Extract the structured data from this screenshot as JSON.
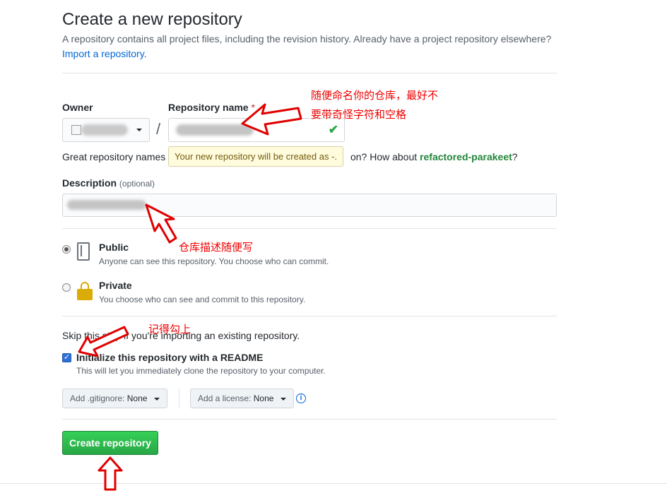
{
  "header": {
    "title": "Create a new repository",
    "subtitle": "A repository contains all project files, including the revision history. Already have a project repository elsewhere?",
    "import_link": "Import a repository."
  },
  "owner": {
    "label": "Owner"
  },
  "repo_name": {
    "label": "Repository name",
    "required_mark": "*",
    "hint_prefix": "Great repository names a",
    "hint_suffix": "on? How about",
    "suggestion": "refactored-parakeet",
    "hint_end": "?",
    "tooltip": "Your new repository will be created as -."
  },
  "description": {
    "label": "Description",
    "optional": "(optional)"
  },
  "visibility": {
    "public": {
      "title": "Public",
      "desc": "Anyone can see this repository. You choose who can commit."
    },
    "private": {
      "title": "Private",
      "desc": "You choose who can see and commit to this repository."
    }
  },
  "skip_text": "Skip this step if you're importing an existing repository.",
  "readme": {
    "label": "Initialize this repository with a README",
    "desc": "This will let you immediately clone the repository to your computer."
  },
  "gitignore": {
    "prefix": "Add .gitignore:",
    "value": "None"
  },
  "license": {
    "prefix": "Add a license:",
    "value": "None"
  },
  "submit_label": "Create repository",
  "annotations": {
    "name_note_line1": "随便命名你的仓库，最好不",
    "name_note_line2": "要带奇怪字符和空格",
    "desc_note": "仓库描述随便写",
    "readme_note": "记得勾上"
  },
  "colors": {
    "accent": "#28a745",
    "link": "#0366d6",
    "annotation": "#ee0000"
  }
}
